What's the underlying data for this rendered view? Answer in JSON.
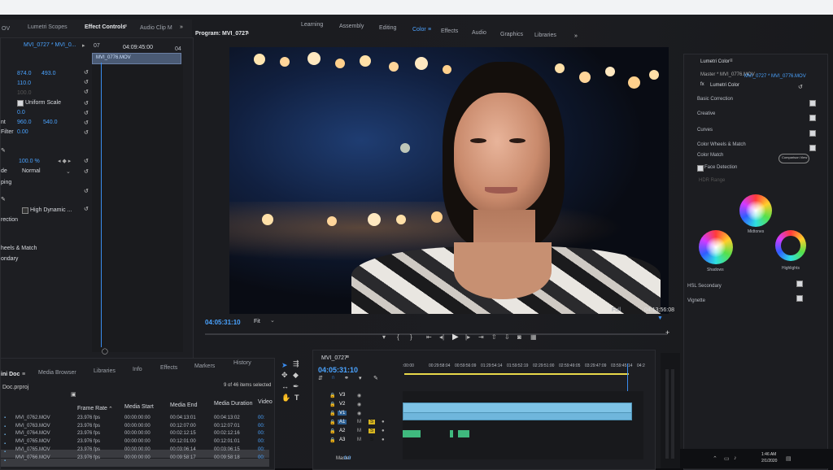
{
  "top_panel_tabs": {
    "left_cut": "OV",
    "lumetri_scopes": "Lumetri Scopes",
    "effect_controls": "Effect Controls",
    "audio_clip": "Audio Clip M",
    "program": "Program: MVI_0727"
  },
  "workspaces": [
    "Learning",
    "Assembly",
    "Editing",
    "Color",
    "Effects",
    "Audio",
    "Graphics",
    "Libraries"
  ],
  "active_workspace": "Color",
  "effect_controls": {
    "source_label": "MVI_0727 * MVI_0...",
    "timecode": "04:09:45:00",
    "mini_clip": "MVI_0776.MOV",
    "ruler_start": "07",
    "ruler_end": "04",
    "position": [
      "874.0",
      "493.0"
    ],
    "scale": "110.0",
    "scale_width": "100.0",
    "uniform_scale": "Uniform Scale",
    "rotation": "0.0",
    "anchor_label": "nt",
    "anchor": [
      "960.0",
      "540.0"
    ],
    "filter_label": "Filter",
    "filter": "0.00",
    "opacity": "100.0 %",
    "blend_label": "de",
    "blend_mode": "Normal",
    "ping": "ping",
    "high_dynamic": "High Dynamic ...",
    "rection": "rection",
    "wheels_match": "heels & Match",
    "ondary": "ondary"
  },
  "program_monitor": {
    "timecode": "04:05:31:10",
    "fit": "Fit",
    "full": "Full",
    "duration": "04:13:56:08"
  },
  "lumetri": {
    "title": "Lumetri Color",
    "source": "Master * MVI_0776.MOV",
    "clip": "MVI_0727 * MVI_0776.MOV",
    "fx": "fx",
    "effect_name": "Lumetri Color",
    "sections": [
      "Basic Correction",
      "Creative",
      "Curves",
      "Color Wheels & Match"
    ],
    "color_match": "Color Match",
    "comparison_view": "Comparison View",
    "face_detection": "Face Detection",
    "hdr_range": "HDR Range",
    "wheel_labels": [
      "Midtones",
      "Shadows",
      "Highlights"
    ],
    "hsl": "HSL Secondary",
    "vignette": "Vignette"
  },
  "project": {
    "tabs": [
      "ini Doc",
      "Media Browser",
      "Libraries",
      "Info",
      "Effects",
      "Markers",
      "History"
    ],
    "file": "Doc.prproj",
    "items_selected": "9 of 46 items selected",
    "columns": [
      "Frame Rate",
      "Media Start",
      "Media End",
      "Media Duration",
      "Video"
    ],
    "rows": [
      {
        "name": "MVI_0762.MOV",
        "fps": "23.976 fps",
        "start": "00:00:00:00",
        "end": "00:04:13:01",
        "dur": "00:04:13:02",
        "video": "00:"
      },
      {
        "name": "MVI_0763.MOV",
        "fps": "23.976 fps",
        "start": "00:00:00:00",
        "end": "00:12:07:00",
        "dur": "00:12:07:01",
        "video": "00:"
      },
      {
        "name": "MVI_0764.MOV",
        "fps": "23.976 fps",
        "start": "00:00:00:00",
        "end": "00:02:12:15",
        "dur": "00:02:12:16",
        "video": "00:"
      },
      {
        "name": "MVI_0765.MOV",
        "fps": "23.976 fps",
        "start": "00:00:00:00",
        "end": "00:12:01:00",
        "dur": "00:12:01:01",
        "video": "00:"
      },
      {
        "name": "MVI_0765.MOV",
        "fps": "23.976 fps",
        "start": "00:00:00:00",
        "end": "00:03:06:14",
        "dur": "00:03:06:15",
        "video": "00:"
      },
      {
        "name": "MVI_0766.MOV",
        "fps": "23.976 fps",
        "start": "00:00:00:00",
        "end": "00:09:58:17",
        "dur": "00:09:58:18",
        "video": "00:"
      }
    ]
  },
  "timeline": {
    "title": "MVI_0727",
    "timecode": "04:05:31:10",
    "ruler": [
      ":00:00",
      "00:29:58:04",
      "00:59:56:09",
      "01:29:54:14",
      "01:59:52:19",
      "02:29:51:00",
      "02:59:49:05",
      "03:29:47:09",
      "03:59:45:14",
      "04:2"
    ],
    "tracks": [
      "V3",
      "V2",
      "V1",
      "A1",
      "A2",
      "A3"
    ],
    "master_label": "Master",
    "master_value": "0.0"
  },
  "taskbar": {
    "time": "1:46 AM",
    "date": "2/1/2020"
  }
}
